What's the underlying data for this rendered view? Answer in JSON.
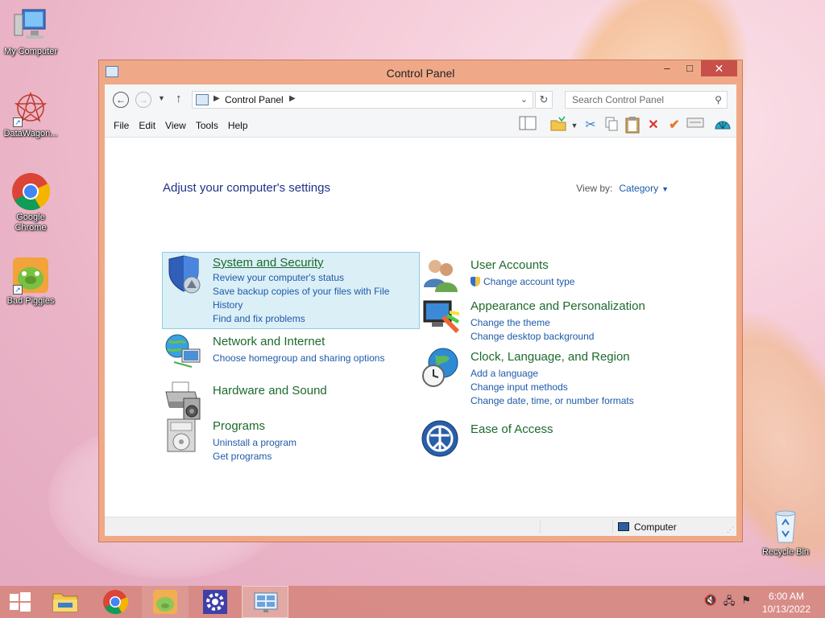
{
  "desktop": {
    "icons": [
      {
        "label": "My Computer",
        "icon": "computer-icon"
      },
      {
        "label": "DataWagon...",
        "icon": "datawagon-icon"
      },
      {
        "label": "Google Chrome",
        "icon": "chrome-icon"
      },
      {
        "label": "Bad Piggies",
        "icon": "bad-piggies-icon"
      },
      {
        "label": "Recycle Bin",
        "icon": "recycle-bin-icon"
      }
    ]
  },
  "window": {
    "title": "Control Panel",
    "buttons": {
      "minimize": "–",
      "maximize": "□",
      "close": "✕"
    }
  },
  "address": {
    "crumb": "Control Panel",
    "search_placeholder": "Search Control Panel"
  },
  "menu": [
    "File",
    "Edit",
    "View",
    "Tools",
    "Help"
  ],
  "content": {
    "heading": "Adjust your computer's settings",
    "view_by_label": "View by:",
    "view_by_value": "Category",
    "categories": [
      {
        "title": "System and Security",
        "icon": "shield-icon",
        "links": [
          "Review your computer's status",
          "Save backup copies of your files with File History",
          "Find and fix problems"
        ]
      },
      {
        "title": "Network and Internet",
        "icon": "network-icon",
        "links": [
          "Choose homegroup and sharing options"
        ]
      },
      {
        "title": "Hardware and Sound",
        "icon": "printer-icon",
        "links": []
      },
      {
        "title": "Programs",
        "icon": "programs-icon",
        "links": [
          "Uninstall a program",
          "Get programs"
        ]
      },
      {
        "title": "User Accounts",
        "icon": "users-icon",
        "links": [
          "Change account type"
        ]
      },
      {
        "title": "Appearance and Personalization",
        "icon": "monitor-paint-icon",
        "links": [
          "Change the theme",
          "Change desktop background"
        ]
      },
      {
        "title": "Clock, Language, and Region",
        "icon": "globe-clock-icon",
        "links": [
          "Add a language",
          "Change input methods",
          "Change date, time, or number formats"
        ]
      },
      {
        "title": "Ease of Access",
        "icon": "ease-of-access-icon",
        "links": []
      }
    ]
  },
  "status": {
    "location": "Computer"
  },
  "taskbar": {
    "items": [
      "start",
      "file-explorer",
      "chrome",
      "bad-piggies",
      "settings",
      "control-panel"
    ],
    "time": "6:00 AM",
    "date": "10/13/2022"
  }
}
